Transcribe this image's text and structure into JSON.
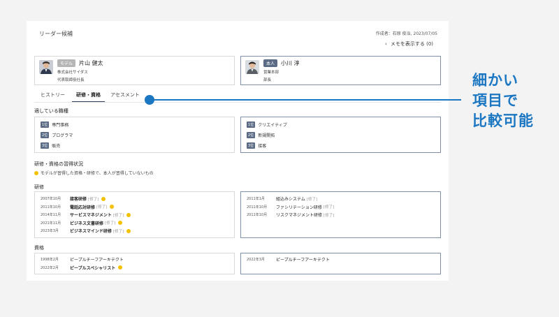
{
  "header": {
    "title": "リーダー候補",
    "author_line": "作成者：石原 俊治, 2023/07/05",
    "memo_link": "メモを表示する (0)"
  },
  "model_person": {
    "tag": "モデル",
    "name": "片山 健太",
    "company": "株式会社サイダス",
    "role": "代表取締役社長"
  },
  "self_person": {
    "tag": "本人",
    "name": "小川 淳",
    "department": "営業本部",
    "role": "部長"
  },
  "tabs": [
    "ヒストリー",
    "研修・資格",
    "アセスメント"
  ],
  "active_tab": "研修・資格",
  "suitable_jobs": {
    "title": "適している職種",
    "model": [
      {
        "rank": "1位",
        "label": "専門事務"
      },
      {
        "rank": "2位",
        "label": "プログラマ"
      },
      {
        "rank": "3位",
        "label": "販売"
      }
    ],
    "self": [
      {
        "rank": "1位",
        "label": "クリエイティブ"
      },
      {
        "rank": "2位",
        "label": "新規開拓"
      },
      {
        "rank": "3位",
        "label": "接客"
      }
    ]
  },
  "acquisition": {
    "title": "研修・資格の習得状況",
    "note": "モデルが習得した資格・研修で、本人が習得していないもの"
  },
  "training": {
    "title": "研修",
    "model": [
      {
        "date": "2007年10月",
        "name": "接客研修",
        "status": "[修了]",
        "highlight": true
      },
      {
        "date": "2011年10月",
        "name": "電話応対研修",
        "status": "[修了]",
        "highlight": true
      },
      {
        "date": "2014年11月",
        "name": "サービスマネジメント",
        "status": "[修了]",
        "highlight": true
      },
      {
        "date": "2021年11月",
        "name": "ビジネス文書研修",
        "status": "[修了]",
        "highlight": true
      },
      {
        "date": "2023年3月",
        "name": "ビジネスマインド研修",
        "status": "[修了]",
        "highlight": true
      }
    ],
    "self": [
      {
        "date": "2011年1月",
        "name": "組込みシステム",
        "status": "[修了]"
      },
      {
        "date": "2011年10月",
        "name": "ファシリテーション研修",
        "status": "[修了]"
      },
      {
        "date": "2011年10月",
        "name": "リスクマネジメント研修",
        "status": "[修了]"
      }
    ]
  },
  "certification": {
    "title": "資格",
    "model": [
      {
        "date": "1998年2月",
        "name": "ピープルチーフアーキテクト",
        "highlight": false
      },
      {
        "date": "2022年2月",
        "name": "ピープルスペシャリスト",
        "highlight": true
      }
    ],
    "self": [
      {
        "date": "2022年3月",
        "name": "ピープルチーフアーキテクト"
      }
    ]
  },
  "callout": {
    "lines": [
      "細かい",
      "項目で",
      "比較可能"
    ]
  },
  "colors": {
    "accent_blue": "#1c77c3",
    "navy_badge": "#5b6b86",
    "highlight_dot": "#f2c200"
  },
  "icons": {
    "memo_chevron": "chevron-left-icon",
    "highlight_marker": "yellow-dot-icon"
  }
}
